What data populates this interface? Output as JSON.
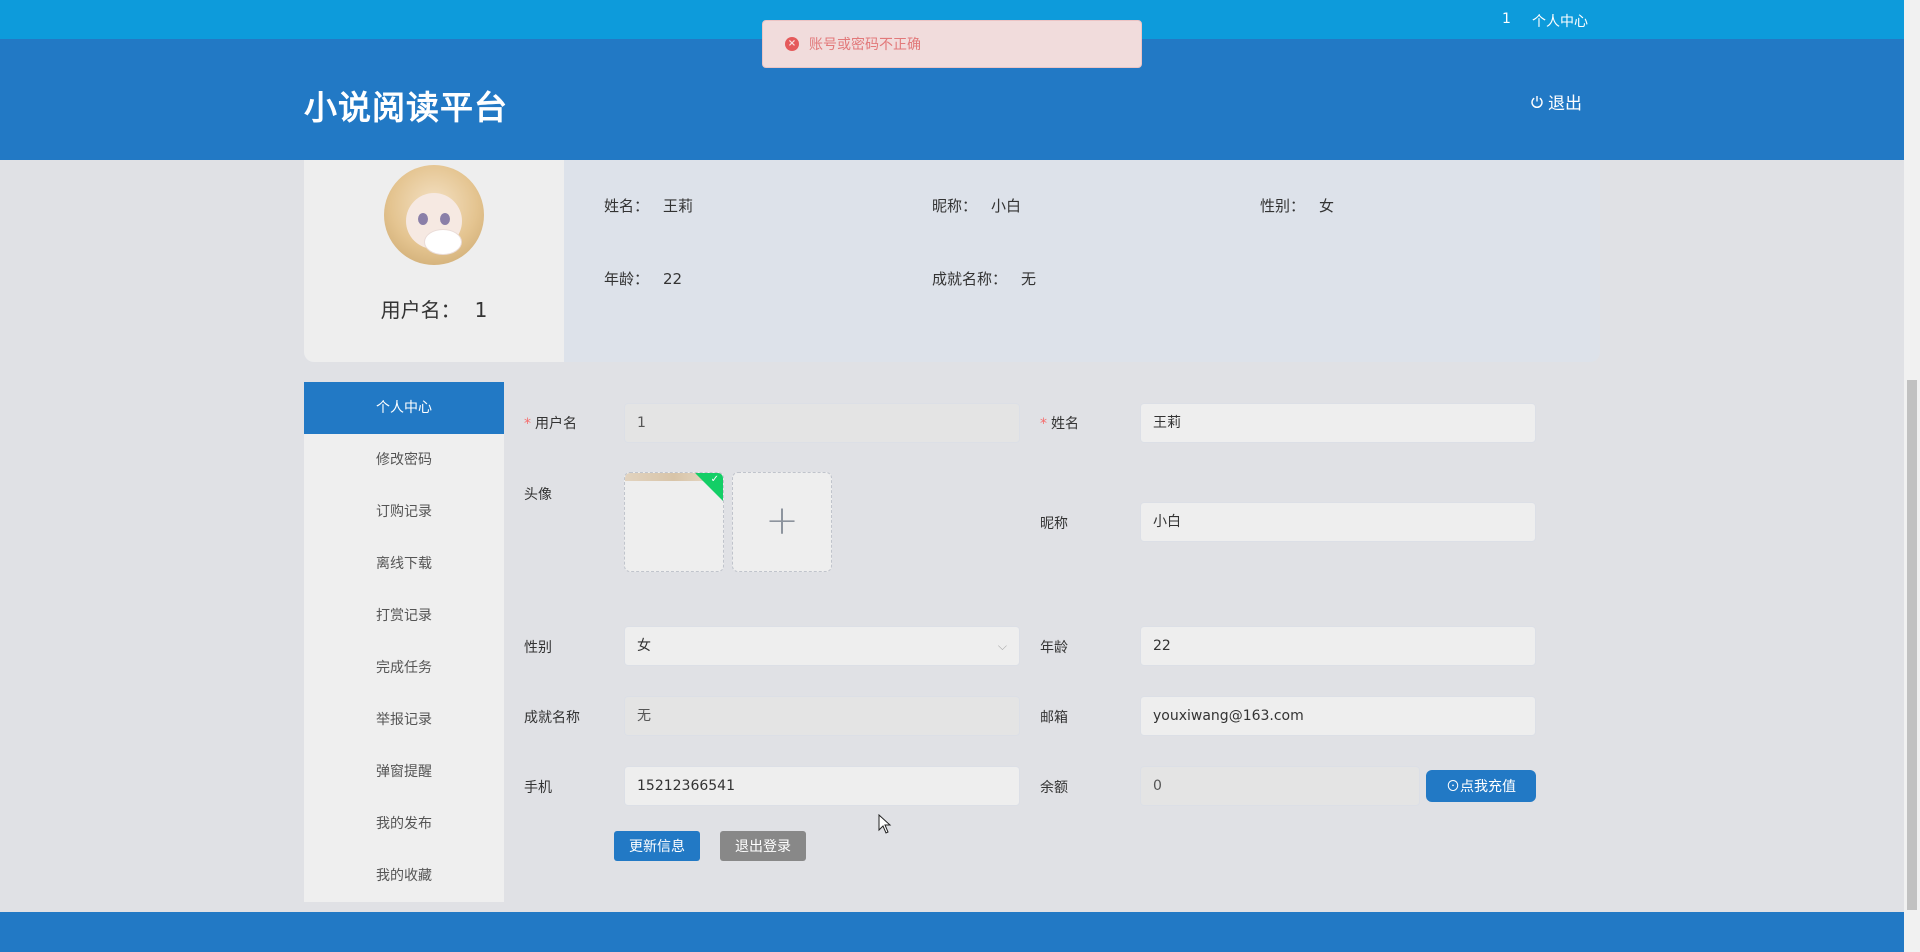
{
  "topbar": {
    "user_id": "1",
    "center_link": "个人中心"
  },
  "header": {
    "title": "小说阅读平台",
    "logout_label": "退出"
  },
  "toast": {
    "message": "账号或密码不正确",
    "icon": "error-circle-icon"
  },
  "profile": {
    "username_label": "用户名：",
    "username_value": "1",
    "info": {
      "name_label": "姓名：",
      "name_value": "王莉",
      "nickname_label": "昵称：",
      "nickname_value": "小白",
      "gender_label": "性别：",
      "gender_value": "女",
      "age_label": "年龄：",
      "age_value": "22",
      "achievement_label": "成就名称：",
      "achievement_value": "无"
    }
  },
  "menu": {
    "items": [
      {
        "label": "个人中心"
      },
      {
        "label": "修改密码"
      },
      {
        "label": "订购记录"
      },
      {
        "label": "离线下载"
      },
      {
        "label": "打赏记录"
      },
      {
        "label": "完成任务"
      },
      {
        "label": "举报记录"
      },
      {
        "label": "弹窗提醒"
      },
      {
        "label": "我的发布"
      },
      {
        "label": "我的收藏"
      }
    ],
    "active_index": 0
  },
  "form": {
    "username_label": "用户名",
    "username_value": "1",
    "name_label": "姓名",
    "name_value": "王莉",
    "avatar_label": "头像",
    "nickname_label": "昵称",
    "nickname_value": "小白",
    "gender_label": "性别",
    "gender_value": "女",
    "age_label": "年龄",
    "age_value": "22",
    "achievement_label": "成就名称",
    "achievement_value": "无",
    "email_label": "邮箱",
    "email_value": "youxiwang@163.com",
    "phone_label": "手机",
    "phone_value": "15212366541",
    "balance_label": "余额",
    "balance_value": "0",
    "recharge_label": "⊙点我充值",
    "update_label": "更新信息",
    "logout_label": "退出登录"
  },
  "colors": {
    "topbar": "#0d9bdb",
    "header": "#2279c5",
    "primary": "#2279c5",
    "error": "#e55a5b",
    "success": "#13ce66"
  }
}
